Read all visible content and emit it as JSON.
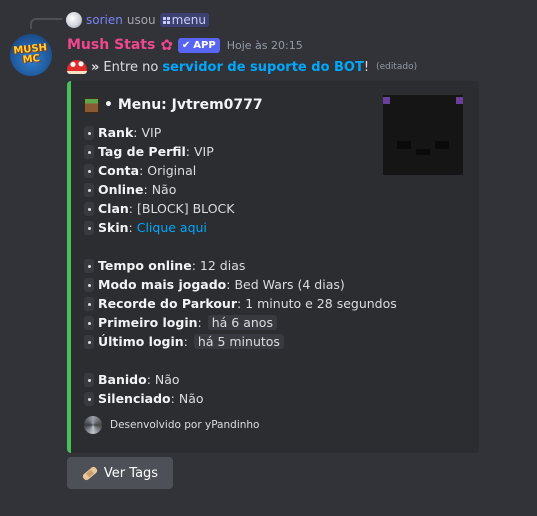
{
  "reply": {
    "user": "sorien",
    "verb": "usou",
    "command": "menu"
  },
  "message": {
    "author": "Mush Stats",
    "app_badge": "APP",
    "timestamp": "Hoje às 20:15",
    "avatar_logo_line1": "MUSH",
    "avatar_logo_line2": "MC",
    "content_prefix": "»",
    "content_text": "Entre no",
    "content_link": "servidor de suporte do BOT",
    "content_suffix": "!",
    "edited": "(editado)"
  },
  "embed": {
    "accent_color": "#48c05a",
    "title": "• Menu: Jvtrem0777",
    "fields_group1": [
      {
        "key": "Rank",
        "value": "VIP"
      },
      {
        "key": "Tag de Perfil",
        "value": "VIP"
      },
      {
        "key": "Conta",
        "value": "Original"
      },
      {
        "key": "Online",
        "value": "Não"
      },
      {
        "key": "Clan",
        "value": "[BLOCK] BLOCK"
      },
      {
        "key": "Skin",
        "value": "Clique aqui"
      }
    ],
    "fields_group2": [
      {
        "key": "Tempo online",
        "value": "12 dias"
      },
      {
        "key": "Modo mais jogado",
        "value": "Bed Wars (4 dias)"
      },
      {
        "key": "Recorde do Parkour",
        "value": "1 minuto e 28 segundos"
      },
      {
        "key": "Primeiro login",
        "value": "há 6 anos"
      },
      {
        "key": "Último login",
        "value": "há 5 minutos"
      }
    ],
    "fields_group3": [
      {
        "key": "Banido",
        "value": "Não"
      },
      {
        "key": "Silenciado",
        "value": "Não"
      }
    ],
    "footer": "Desenvolvido por yPandinho"
  },
  "button": {
    "label": "Ver Tags"
  },
  "colors": {
    "background": "#323339",
    "embed_bg": "#2b2d31",
    "username": "#f0478e",
    "link": "#00a8fc",
    "app_badge": "#5865f2",
    "button": "#4e5058"
  }
}
